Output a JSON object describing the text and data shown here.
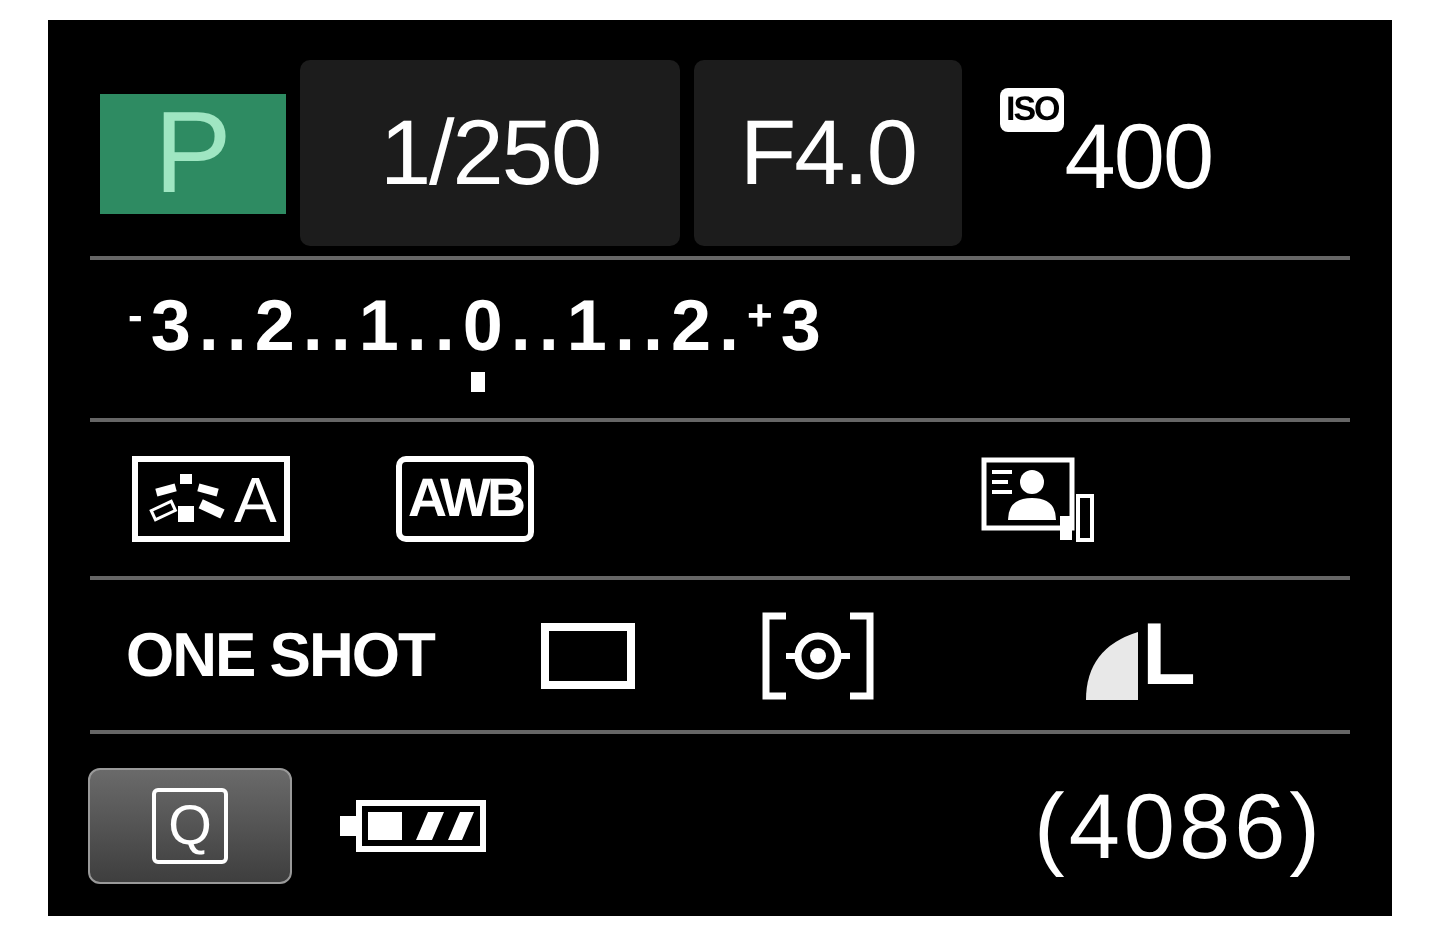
{
  "mode": "P",
  "shutter_speed": "1/250",
  "aperture": "F4.0",
  "iso": {
    "badge": "ISO",
    "value": "400"
  },
  "exposure_scale": {
    "label": "$^{-}$3..2..1..0..1..2.$^{+}$3"
  },
  "picture_style": "A",
  "white_balance": "AWB",
  "focus_mode": "ONE SHOT",
  "image_quality": "L",
  "quick_control": "Q",
  "shots_remaining": "(4086)"
}
